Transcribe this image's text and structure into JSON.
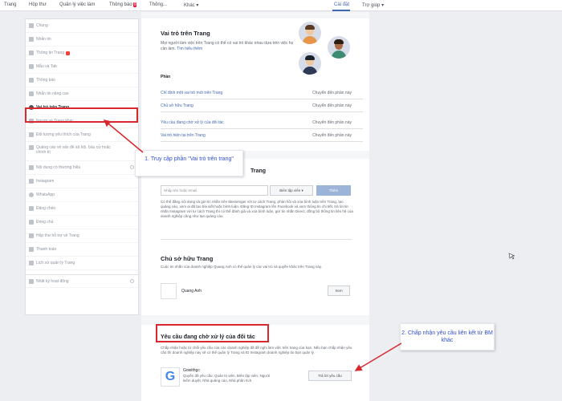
{
  "topbar": {
    "items": [
      "Trang",
      "Hộp thư",
      "Quản lý việc làm",
      "Thông báo",
      "Thông...",
      "Khác",
      "Cài đặt",
      "Trợ giúp"
    ],
    "notif_badge": "9"
  },
  "sidebar": {
    "items": [
      {
        "label": "Chung"
      },
      {
        "label": "Nhắn tin"
      },
      {
        "label": "Thông tin Trang"
      },
      {
        "label": "Mẫu và Tab"
      },
      {
        "label": "Thông báo"
      },
      {
        "label": "Nhắn tin nâng cao"
      },
      {
        "label": "Vai trò trên Trang"
      },
      {
        "label": "Người và Trang khác"
      },
      {
        "label": "Đối tượng yêu thích của Trang"
      },
      {
        "label": "Quảng cáo về vấn đề xã hội, bầu cử hoặc chính trị"
      },
      {
        "label": "Nội dung có thương hiệu"
      },
      {
        "label": "Instagram"
      },
      {
        "label": "WhatsApp"
      },
      {
        "label": "Đăng chéo"
      },
      {
        "label": "Đóng chủ"
      },
      {
        "label": "Hộp thư hỗ trợ về Trang"
      },
      {
        "label": "Thanh toán"
      },
      {
        "label": "Lịch sử quản lý Trang"
      },
      {
        "label": "Nhật ký hoạt động"
      }
    ]
  },
  "roles": {
    "title": "Vai trò trên Trang",
    "desc": "Mọi người làm việc trên Trang có thể có vai trò khác nhau dựa trên việc họ cần làm.",
    "learn_more": "Tìm hiểu thêm",
    "section_label": "Phần",
    "rows": [
      {
        "label": "Chỉ định một vai trò mới trên Trang",
        "action": "Chuyển đến phần này"
      },
      {
        "label": "Chủ sở hữu Trang",
        "action": "Chuyển đến phần này"
      },
      {
        "label": "Yêu cầu đang chờ xử lý của đối tác",
        "action": "Chuyển đến phần này"
      },
      {
        "label": "Vai trò hiện tại trên Trang",
        "action": "Chuyển đến phần này"
      }
    ]
  },
  "assign": {
    "title_tail": "Trang",
    "input_placeholder": "Nhập tên hoặc email",
    "role_select": "Biên tập viên",
    "add_button": "Thêm",
    "desc": "Có thể đăng nội dung và gửi tin nhắn trên Messenger với tư cách Trang, phản hồi và xóa bình luận trên Trang, tạo quảng cáo, xem ai đã tạo bài viết hoặc bình luận. Đăng ID Instagram lên Facebook và xem thông tin chi tiết, trả lời tin nhắn Instagram với tư cách Trang thì có thể đánh giá và xóa bình luận, gửi tin nhắn Direct, đồng bộ thông tin liên hệ của doanh nghiệp cũng như tạo quảng cáo."
  },
  "owner": {
    "title": "Chủ sở hữu Trang",
    "desc": "Cuộc tin nhắn của doanh nghiệp Quang Anh có thể quản lý các vai trò và quyền khác trên Trang này.",
    "name": "Quang Anh",
    "button": "Xem"
  },
  "pending": {
    "title": "Yêu cầu đang chờ xử lý của đối tác",
    "desc": "Chấp nhận hoặc từ chối yêu cầu của các doanh nghiệp đã đề nghị làm việc trên trang của bạn. Nếu bạn chấp nhận yêu cầu thì doanh nghiệp này sẽ có thể quản lý Trang và ID Instagram doanh nghiệp do bạn quản lý.",
    "item_name": "Gowithgc",
    "item_desc": "Quyền đã yêu cầu: Quản trị viên, Biên tập viên, Người kiểm duyệt, Nhà quảng cáo, Nhà phân tích",
    "button": "Trả lời yêu cầu",
    "logo_letter": "G"
  },
  "annotations": {
    "note1": "1. Truy cập phần \"Vai trò trên trang\"",
    "note2": "2. Chấp nhận yêu cầu liên kết từ BM khác"
  },
  "colors": {
    "accent": "#4267b2",
    "annotation_red": "#d8282e",
    "annotation_text": "#2f4fcf"
  }
}
